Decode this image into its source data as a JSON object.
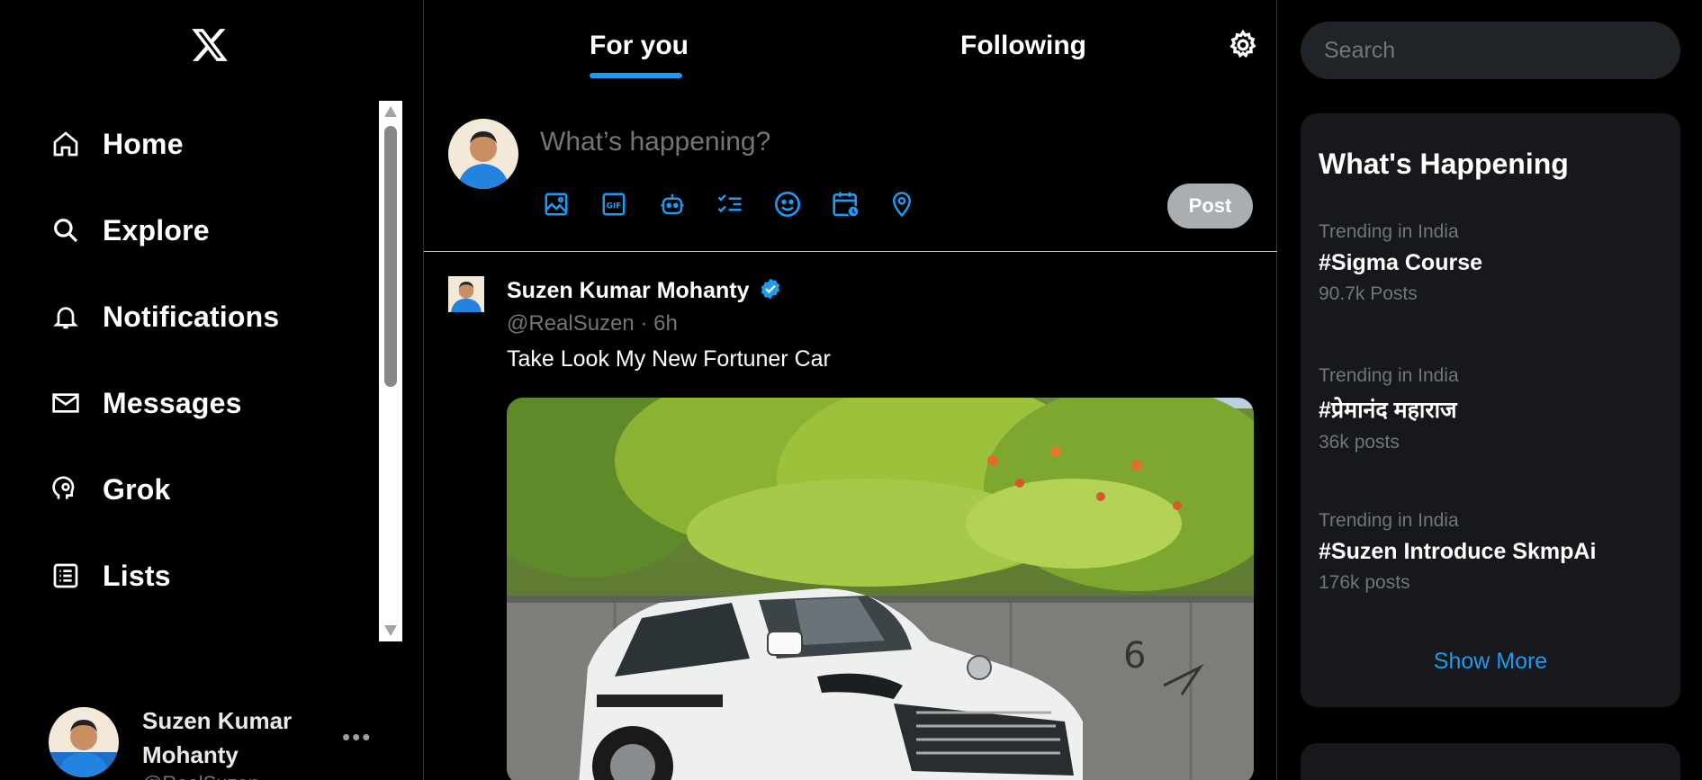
{
  "sidebar": {
    "nav": [
      {
        "label": "Home",
        "icon": "home-icon"
      },
      {
        "label": "Explore",
        "icon": "search-icon"
      },
      {
        "label": "Notifications",
        "icon": "bell-icon"
      },
      {
        "label": "Messages",
        "icon": "envelope-icon"
      },
      {
        "label": "Grok",
        "icon": "grok-icon"
      },
      {
        "label": "Lists",
        "icon": "list-icon"
      }
    ],
    "profile": {
      "name": "Suzen Kumar Mohanty",
      "handle": "@RealSuzen",
      "more": "•••"
    }
  },
  "header": {
    "tabs": [
      {
        "label": "For you",
        "active": true
      },
      {
        "label": "Following",
        "active": false
      }
    ]
  },
  "compose": {
    "placeholder": "What’s happening?",
    "tools": [
      "image-icon",
      "gif-icon",
      "grok-bot-icon",
      "poll-icon",
      "emoji-icon",
      "schedule-icon",
      "location-icon"
    ],
    "post_label": "Post"
  },
  "tweet": {
    "name": "Suzen Kumar Mohanty",
    "meta": "@RealSuzen · 6h",
    "text": "Take Look My New Fortuner Car"
  },
  "right": {
    "search_placeholder": "Search",
    "panel_title": "What's Happening",
    "trends": [
      {
        "context": "Trending in India",
        "tag": "#Sigma Course",
        "count": "90.7k Posts"
      },
      {
        "context": "Trending in India",
        "tag": "#प्रेमानंद महाराज",
        "count": "36k posts"
      },
      {
        "context": "Trending in India",
        "tag": "#Suzen Introduce SkmpAi",
        "count": "176k posts"
      }
    ],
    "show_more": "Show More"
  },
  "colors": {
    "accent": "#1d9bf0",
    "background": "#000000",
    "panel": "#16181c",
    "muted": "#71767b"
  }
}
